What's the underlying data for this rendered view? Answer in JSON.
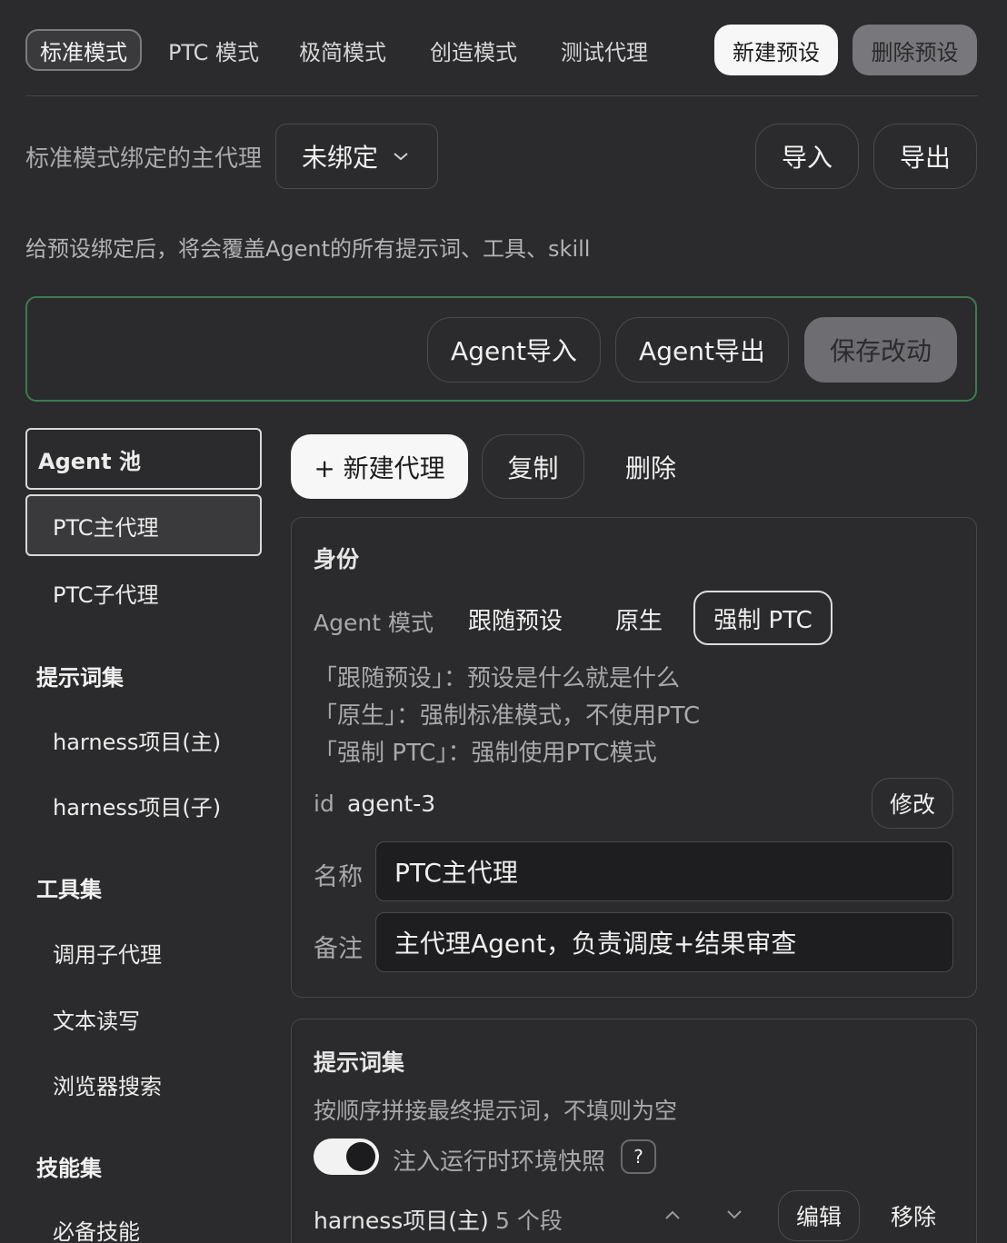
{
  "mode_tabs": [
    {
      "label": "标准模式",
      "active": true
    },
    {
      "label": "PTC 模式"
    },
    {
      "label": "极简模式"
    },
    {
      "label": "创造模式"
    },
    {
      "label": "测试代理"
    }
  ],
  "header": {
    "new_preset": "新建预设",
    "delete_preset": "删除预设"
  },
  "binding": {
    "label": "标准模式绑定的主代理",
    "select_value": "未绑定",
    "import": "导入",
    "export": "导出",
    "note": "给预设绑定后，将会覆盖Agent的所有提示词、工具、skill"
  },
  "agent_actions": {
    "import": "Agent导入",
    "export": "Agent导出",
    "save": "保存改动"
  },
  "sidebar": {
    "agent_pool": "Agent 池",
    "agents": [
      "PTC主代理",
      "PTC子代理"
    ],
    "prompt_sets_title": "提示词集",
    "prompt_sets": [
      "harness项目(主)",
      "harness项目(子)"
    ],
    "toolsets_title": "工具集",
    "toolsets": [
      "调用子代理",
      "文本读写",
      "浏览器搜索"
    ],
    "skills_title": "技能集",
    "skills": [
      "必备技能"
    ]
  },
  "toolbar": {
    "new_agent": "+ 新建代理",
    "copy": "复制",
    "delete": "删除"
  },
  "identity": {
    "title": "身份",
    "mode_label": "Agent 模式",
    "mode_options": [
      "跟随预设",
      "原生",
      "强制 PTC"
    ],
    "mode_selected": "强制 PTC",
    "help": [
      "「跟随预设」：预设是什么就是什么",
      "「原生」：强制标准模式，不使用PTC",
      "「强制 PTC」：强制使用PTC模式"
    ],
    "id_label": "id",
    "id_value": "agent-3",
    "modify": "修改",
    "name_label": "名称",
    "name_value": "PTC主代理",
    "remark_label": "备注",
    "remark_value": "主代理Agent，负责调度+结果审查"
  },
  "prompts": {
    "title": "提示词集",
    "desc": "按顺序拼接最终提示词，不填则为空",
    "toggle_label": "注入运行时环境快照",
    "toggle_on": true,
    "help_mark": "?",
    "row_name": "harness项目(主)",
    "row_count": "5 个段",
    "edit": "编辑",
    "remove": "移除"
  },
  "colors": {
    "background": "#2b2b2d",
    "accent_green": "#3d7a52",
    "white_button": "#f7f7f7"
  }
}
